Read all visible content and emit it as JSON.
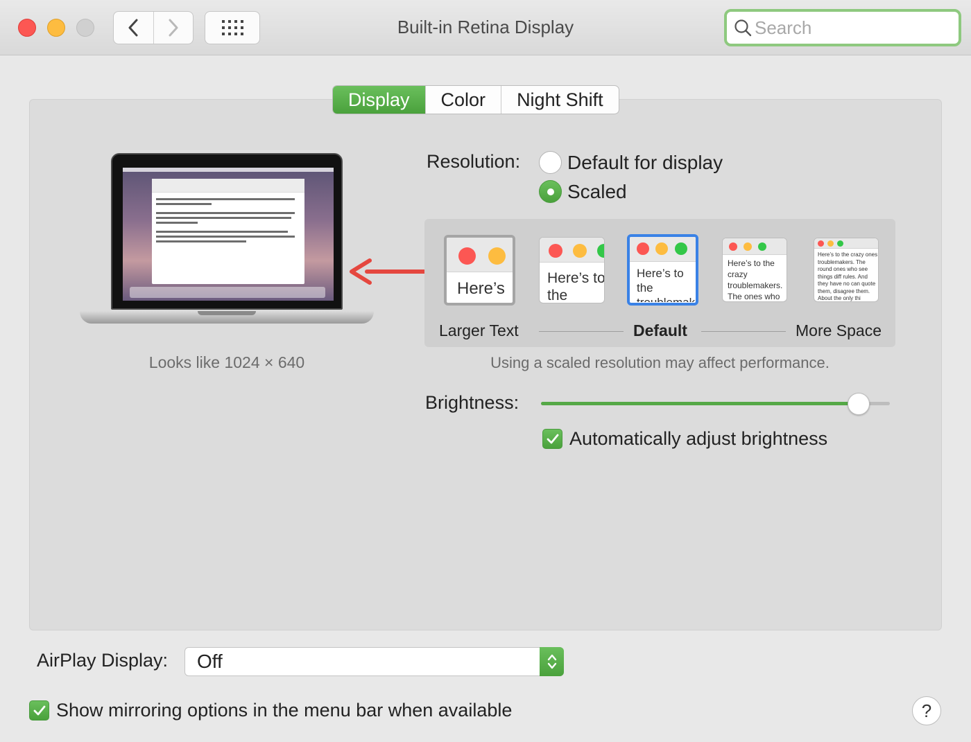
{
  "window": {
    "title": "Built-in Retina Display",
    "search_placeholder": "Search"
  },
  "tabs": [
    {
      "label": "Display",
      "active": true
    },
    {
      "label": "Color",
      "active": false
    },
    {
      "label": "Night Shift",
      "active": false
    }
  ],
  "preview": {
    "looks_like": "Looks like 1024 × 640"
  },
  "resolution": {
    "label": "Resolution:",
    "options": [
      {
        "label": "Default for display",
        "selected": false
      },
      {
        "label": "Scaled",
        "selected": true
      }
    ],
    "scale_thumbnails": [
      {
        "text": "Here’s",
        "state": "hovered"
      },
      {
        "text": "Here’s to the troublemakers",
        "state": "normal"
      },
      {
        "text": "Here’s to the troublemakers. ones who",
        "state": "selected"
      },
      {
        "text": "Here’s to the crazy troublemakers. The ones who see t rules. And they",
        "state": "normal"
      },
      {
        "text": "Here’s to the crazy ones troublemakers. The round ones who see things diff rules. And they have no can quote them, disagree them. About the only thi Because they change th",
        "state": "normal"
      }
    ],
    "scale_labels": {
      "left": "Larger Text",
      "middle": "Default",
      "right": "More Space"
    },
    "note": "Using a scaled resolution may affect performance."
  },
  "brightness": {
    "label": "Brightness:",
    "value": 0.91,
    "auto_label": "Automatically adjust brightness",
    "auto_checked": true
  },
  "airplay": {
    "label": "AirPlay Display:",
    "value": "Off"
  },
  "mirroring": {
    "label": "Show mirroring options in the menu bar when available",
    "checked": true
  },
  "help": {
    "label": "?"
  },
  "colors": {
    "accent": "#55a847",
    "focus_ring": "#8ec97f",
    "selection_blue": "#3a82e6",
    "arrow_red": "#e5473f"
  },
  "icons": [
    "back-chevron-icon",
    "forward-chevron-icon",
    "grid-icon",
    "search-icon",
    "checkmark-icon",
    "stepper-arrows-icon",
    "red-arrow-icon"
  ]
}
